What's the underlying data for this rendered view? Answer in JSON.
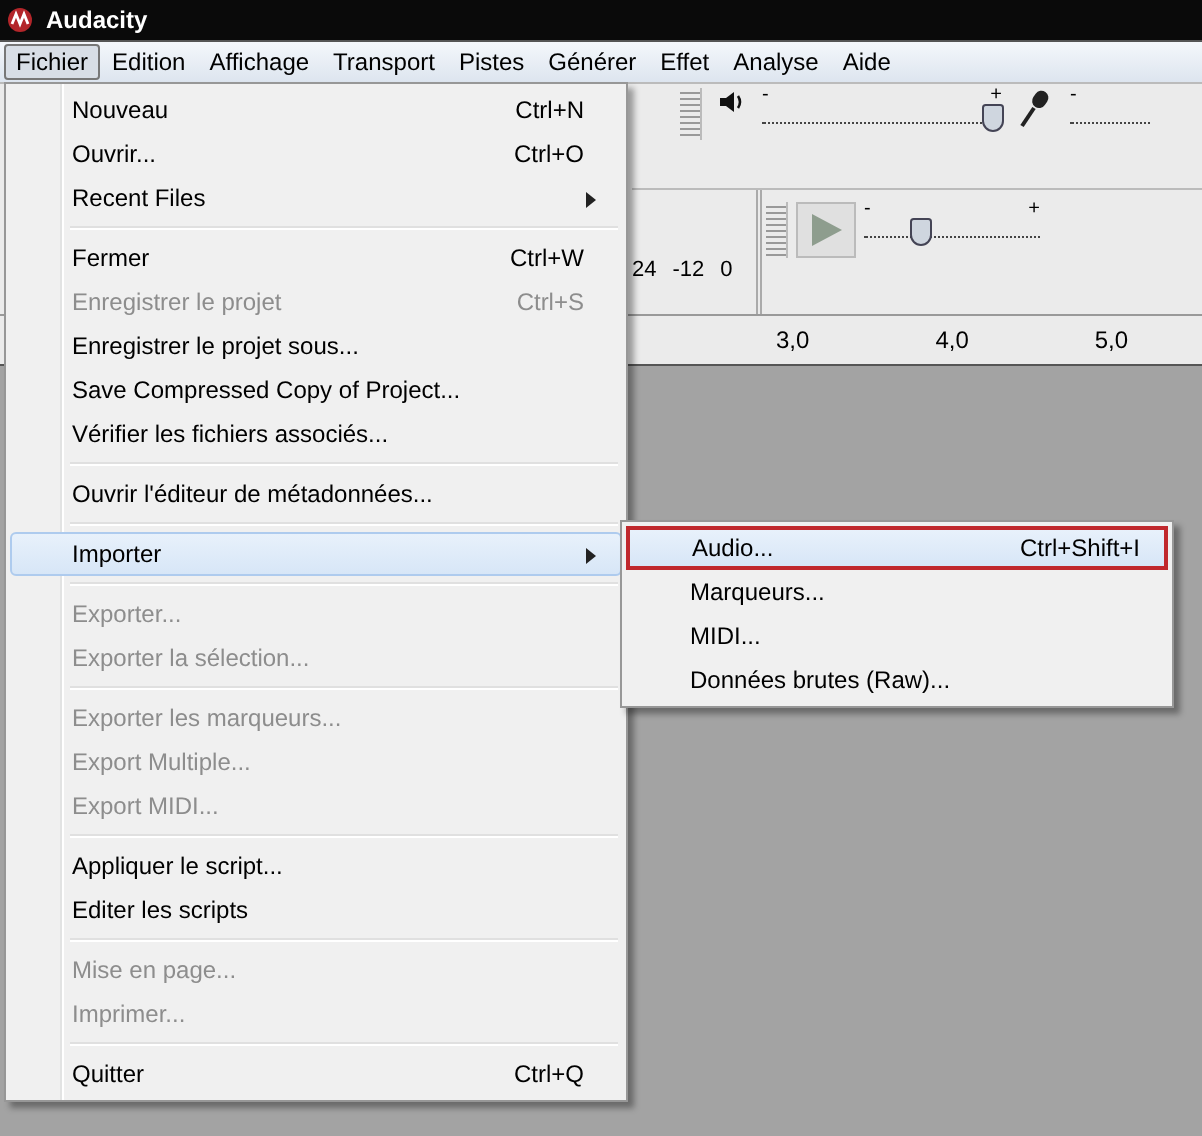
{
  "window": {
    "title": "Audacity"
  },
  "menubar": [
    {
      "label": "Fichier",
      "selected": true
    },
    {
      "label": "Edition",
      "selected": false
    },
    {
      "label": "Affichage",
      "selected": false
    },
    {
      "label": "Transport",
      "selected": false
    },
    {
      "label": "Pistes",
      "selected": false
    },
    {
      "label": "Générer",
      "selected": false
    },
    {
      "label": "Effet",
      "selected": false
    },
    {
      "label": "Analyse",
      "selected": false
    },
    {
      "label": "Aide",
      "selected": false
    }
  ],
  "toolbars": {
    "playback_volume": {
      "minus": "-",
      "plus": "+",
      "level": 0.97
    },
    "recording_volume": {
      "minus": "-"
    },
    "play_speed": {
      "minus": "-",
      "plus": "+",
      "level": 0.33
    },
    "meter_scale": [
      "24",
      "-12",
      "0"
    ],
    "ruler": [
      "3,0",
      "4,0",
      "5,0"
    ]
  },
  "menu": {
    "groups": [
      [
        {
          "label": "Nouveau",
          "shortcut": "Ctrl+N",
          "disabled": false,
          "submenu": false,
          "selected": false
        },
        {
          "label": "Ouvrir...",
          "shortcut": "Ctrl+O",
          "disabled": false,
          "submenu": false,
          "selected": false
        },
        {
          "label": "Recent Files",
          "disabled": false,
          "submenu": true,
          "selected": false
        }
      ],
      [
        {
          "label": "Fermer",
          "shortcut": "Ctrl+W",
          "disabled": false,
          "submenu": false,
          "selected": false
        },
        {
          "label": "Enregistrer le projet",
          "shortcut": "Ctrl+S",
          "disabled": true,
          "submenu": false,
          "selected": false
        },
        {
          "label": "Enregistrer le projet sous...",
          "disabled": false,
          "submenu": false,
          "selected": false
        },
        {
          "label": "Save Compressed Copy of Project...",
          "disabled": false,
          "submenu": false,
          "selected": false
        },
        {
          "label": "Vérifier les fichiers associés...",
          "disabled": false,
          "submenu": false,
          "selected": false
        }
      ],
      [
        {
          "label": "Ouvrir l'éditeur de métadonnées...",
          "disabled": false,
          "submenu": false,
          "selected": false
        }
      ],
      [
        {
          "label": "Importer",
          "disabled": false,
          "submenu": true,
          "selected": true
        }
      ],
      [
        {
          "label": "Exporter...",
          "disabled": true,
          "submenu": false,
          "selected": false
        },
        {
          "label": "Exporter la sélection...",
          "disabled": true,
          "submenu": false,
          "selected": false
        }
      ],
      [
        {
          "label": "Exporter les marqueurs...",
          "disabled": true,
          "submenu": false,
          "selected": false
        },
        {
          "label": "Export Multiple...",
          "disabled": true,
          "submenu": false,
          "selected": false
        },
        {
          "label": "Export MIDI...",
          "disabled": true,
          "submenu": false,
          "selected": false
        }
      ],
      [
        {
          "label": "Appliquer le script...",
          "disabled": false,
          "submenu": false,
          "selected": false
        },
        {
          "label": "Editer les scripts",
          "disabled": false,
          "submenu": false,
          "selected": false
        }
      ],
      [
        {
          "label": "Mise en page...",
          "disabled": true,
          "submenu": false,
          "selected": false
        },
        {
          "label": "Imprimer...",
          "disabled": true,
          "submenu": false,
          "selected": false
        }
      ],
      [
        {
          "label": "Quitter",
          "shortcut": "Ctrl+Q",
          "disabled": false,
          "submenu": false,
          "selected": false
        }
      ]
    ]
  },
  "submenu": {
    "items": [
      {
        "label": "Audio...",
        "shortcut": "Ctrl+Shift+I",
        "selected": true
      },
      {
        "label": "Marqueurs...",
        "selected": false
      },
      {
        "label": "MIDI...",
        "selected": false
      },
      {
        "label": "Données brutes (Raw)...",
        "selected": false
      }
    ]
  }
}
